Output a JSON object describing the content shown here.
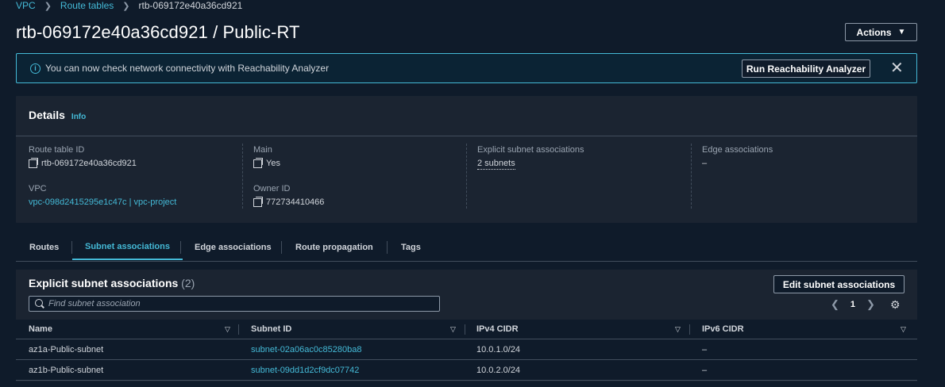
{
  "breadcrumb": {
    "vpc": "VPC",
    "route_tables": "Route tables",
    "current": "rtb-069172e40a36cd921"
  },
  "page": {
    "title": "rtb-069172e40a36cd921 / Public-RT",
    "actions_label": "Actions"
  },
  "banner": {
    "message": "You can now check network connectivity with Reachability Analyzer",
    "button_label": "Run Reachability Analyzer",
    "close": "✕"
  },
  "details": {
    "heading": "Details",
    "info": "Info",
    "route_table_id": {
      "label": "Route table ID",
      "value": "rtb-069172e40a36cd921"
    },
    "vpc": {
      "label": "VPC",
      "value": "vpc-098d2415295e1c47c | vpc-project"
    },
    "main": {
      "label": "Main",
      "value": "Yes"
    },
    "owner_id": {
      "label": "Owner ID",
      "value": "772734410466"
    },
    "explicit": {
      "label": "Explicit subnet associations",
      "value": "2 subnets"
    },
    "edge": {
      "label": "Edge associations",
      "value": "–"
    }
  },
  "tabs": [
    {
      "label": "Routes"
    },
    {
      "label": "Subnet associations"
    },
    {
      "label": "Edge associations"
    },
    {
      "label": "Route propagation"
    },
    {
      "label": "Tags"
    }
  ],
  "subnet_table": {
    "title": "Explicit subnet associations",
    "count": "(2)",
    "edit_label": "Edit subnet associations",
    "search_placeholder": "Find subnet association",
    "page": "1",
    "columns": [
      "Name",
      "Subnet ID",
      "IPv4 CIDR",
      "IPv6 CIDR"
    ],
    "rows": [
      {
        "name": "az1a-Public-subnet",
        "subnet_id": "subnet-02a06ac0c85280ba8",
        "ipv4": "10.0.1.0/24",
        "ipv6": "–"
      },
      {
        "name": "az1b-Public-subnet",
        "subnet_id": "subnet-09dd1d2cf9dc07742",
        "ipv4": "10.0.2.0/24",
        "ipv6": "–"
      }
    ]
  },
  "colors": {
    "background": "#0f1b2a",
    "panel": "#1b2431",
    "accent": "#44b9d6",
    "border": "#414d5c"
  }
}
